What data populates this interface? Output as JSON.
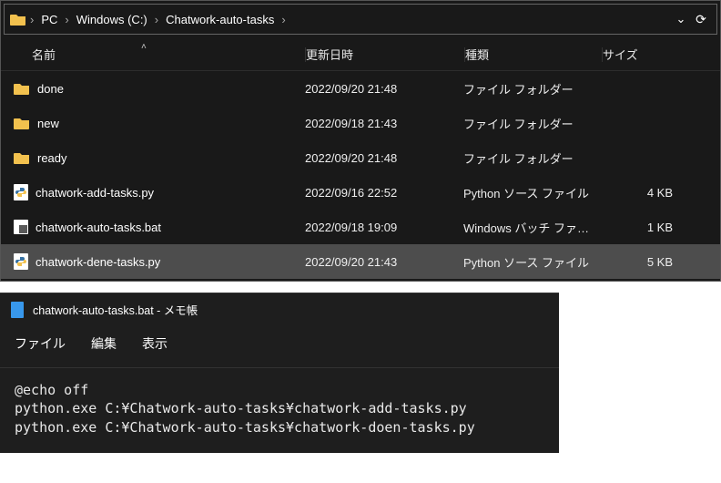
{
  "breadcrumb": {
    "pc": "PC",
    "drive": "Windows (C:)",
    "folder": "Chatwork-auto-tasks"
  },
  "columns": {
    "name": "名前",
    "date": "更新日時",
    "type": "種類",
    "size": "サイズ"
  },
  "rows": [
    {
      "icon": "folder",
      "name": "done",
      "date": "2022/09/20 21:48",
      "type": "ファイル フォルダー",
      "size": "",
      "selected": false
    },
    {
      "icon": "folder",
      "name": "new",
      "date": "2022/09/18 21:43",
      "type": "ファイル フォルダー",
      "size": "",
      "selected": false
    },
    {
      "icon": "folder",
      "name": "ready",
      "date": "2022/09/20 21:48",
      "type": "ファイル フォルダー",
      "size": "",
      "selected": false
    },
    {
      "icon": "python",
      "name": "chatwork-add-tasks.py",
      "date": "2022/09/16 22:52",
      "type": "Python ソース ファイル",
      "size": "4 KB",
      "selected": false
    },
    {
      "icon": "bat",
      "name": "chatwork-auto-tasks.bat",
      "date": "2022/09/18 19:09",
      "type": "Windows バッチ ファ…",
      "size": "1 KB",
      "selected": false
    },
    {
      "icon": "python",
      "name": "chatwork-dene-tasks.py",
      "date": "2022/09/20 21:43",
      "type": "Python ソース ファイル",
      "size": "5 KB",
      "selected": true
    }
  ],
  "notepad": {
    "title": "chatwork-auto-tasks.bat - メモ帳",
    "menu": {
      "file": "ファイル",
      "edit": "編集",
      "view": "表示"
    },
    "content": "@echo off\npython.exe C:¥Chatwork-auto-tasks¥chatwork-add-tasks.py\npython.exe C:¥Chatwork-auto-tasks¥chatwork-doen-tasks.py"
  }
}
